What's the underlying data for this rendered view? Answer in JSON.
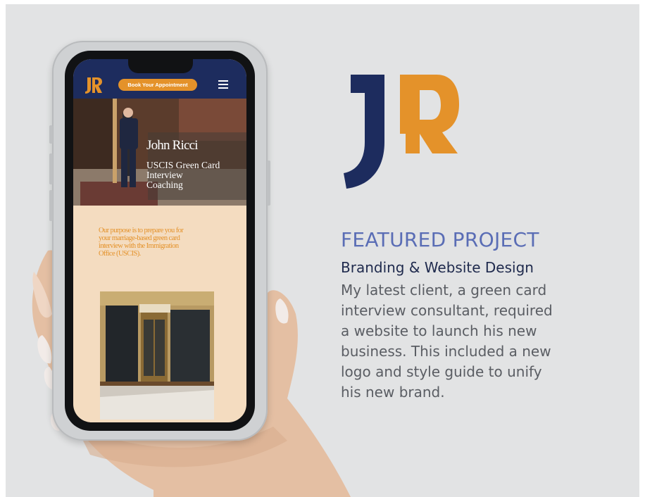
{
  "colors": {
    "navy": "#1d2c5e",
    "orange": "#e4922a",
    "accent_blue": "#5a6db5",
    "panel_bg": "#e2e3e4",
    "screen_bg": "#f4dcc0"
  },
  "phone_site": {
    "logo_text": "JR",
    "book_button": "Book Your Appointment",
    "menu_icon": "hamburger-menu-icon",
    "hero": {
      "name": "John Ricci",
      "subtitle_lines": [
        "USCIS Green Card",
        "Interview",
        "Coaching"
      ]
    },
    "purpose_lines": [
      "Our purpose is to prepare you for",
      "your marriage-based green card",
      "interview with the Immigration",
      "Office (USCIS)."
    ]
  },
  "project": {
    "logo_text": "JR",
    "featured_label": "FEATURED PROJECT",
    "title": "Branding & Website Design",
    "description_lines": [
      "My latest client, a green card",
      "interview consultant, required",
      "a website to launch his new",
      "business. This included a new",
      "logo and style guide to unify",
      "his new brand."
    ]
  }
}
